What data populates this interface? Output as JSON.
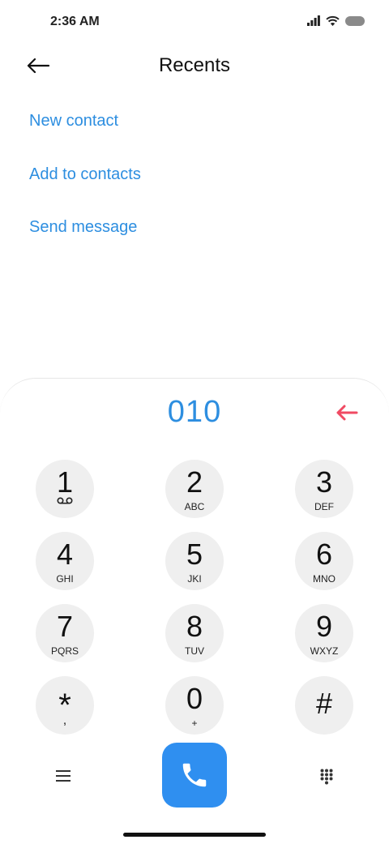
{
  "status_bar": {
    "time": "2:36 AM",
    "icons": [
      "signal-icon",
      "wifi-icon",
      "battery-icon"
    ]
  },
  "header": {
    "title": "Recents",
    "back_icon": "arrow-left-icon"
  },
  "menu": {
    "items": [
      {
        "label": "New contact"
      },
      {
        "label": "Add to contacts"
      },
      {
        "label": "Send message"
      }
    ]
  },
  "dialpad": {
    "number": "010",
    "keys": [
      {
        "digit": "1",
        "letters": ""
      },
      {
        "digit": "2",
        "letters": "ABC"
      },
      {
        "digit": "3",
        "letters": "DEF"
      },
      {
        "digit": "4",
        "letters": "GHI"
      },
      {
        "digit": "5",
        "letters": "JKI"
      },
      {
        "digit": "6",
        "letters": "MNO"
      },
      {
        "digit": "7",
        "letters": "PQRS"
      },
      {
        "digit": "8",
        "letters": "TUV"
      },
      {
        "digit": "9",
        "letters": "WXYZ"
      },
      {
        "digit": "*",
        "letters": ","
      },
      {
        "digit": "0",
        "letters": "+"
      },
      {
        "digit": "#",
        "letters": ""
      }
    ]
  },
  "colors": {
    "accent": "#2d8ee0",
    "call_button": "#2f8ff0",
    "backspace": "#f04a63",
    "key_background": "#efefef"
  }
}
